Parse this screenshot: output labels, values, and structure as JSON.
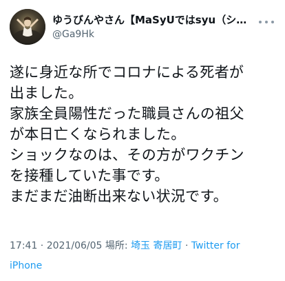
{
  "author": {
    "display_name": "ゆうびんやさん【MaSyUではsyu（シ…",
    "handle": "@Ga9Hk"
  },
  "tweet": {
    "lines": [
      "遂に身近な所でコロナによる死者が",
      "出ました。",
      "家族全員陽性だった職員さんの祖父",
      "が本日亡くなられました。",
      "ショックなのは、その方がワクチン",
      "を接種していた事です。",
      "まだまだ油断出来ない状況です。"
    ]
  },
  "meta": {
    "time": "17:41",
    "separator_1": " · ",
    "date": "2021/06/05",
    "location_label": " 場所: ",
    "location": "埼玉 寄居町",
    "separator_2": " · ",
    "source_part1": "Twitter for",
    "source_part2": "iPhone"
  },
  "colors": {
    "link": "#1d9bf0",
    "secondary_text": "#536471",
    "primary_text": "#0f1419"
  },
  "icons": {
    "more": "more-options-icon",
    "avatar": "profile-avatar"
  }
}
